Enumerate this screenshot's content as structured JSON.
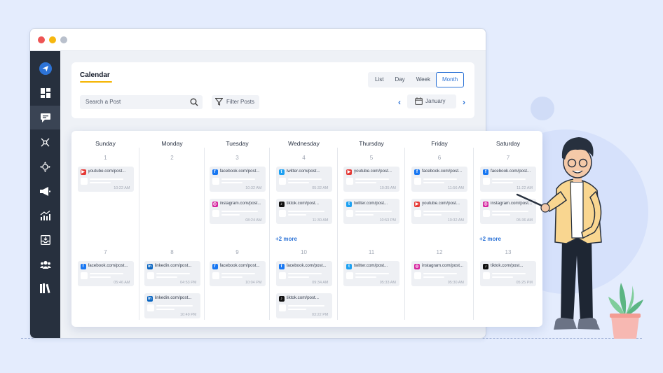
{
  "window": {
    "dots": [
      "#ee5454",
      "#f6b70f",
      "#b9c0cc"
    ]
  },
  "colors": {
    "accent": "#2d73d6",
    "sidebar": "#27303e",
    "underline": "#f5b400"
  },
  "sidebar": {
    "items": [
      {
        "icon": "send-icon",
        "active": false,
        "brand": true
      },
      {
        "icon": "dashboard-icon",
        "active": false
      },
      {
        "icon": "calendar-posts-icon",
        "active": true
      },
      {
        "icon": "network-icon",
        "active": false
      },
      {
        "icon": "move-icon",
        "active": false
      },
      {
        "icon": "megaphone-icon",
        "active": false
      },
      {
        "icon": "analytics-icon",
        "active": false
      },
      {
        "icon": "inbox-icon",
        "active": false
      },
      {
        "icon": "users-icon",
        "active": false
      },
      {
        "icon": "library-icon",
        "active": false
      }
    ]
  },
  "header": {
    "title": "Calendar",
    "views": [
      "List",
      "Day",
      "Week",
      "Month"
    ],
    "active_view": "Month",
    "search_placeholder": "Search a Post",
    "filter_label": "Filter Posts",
    "month": "January",
    "prev": "‹",
    "next": "›"
  },
  "calendar": {
    "days": [
      {
        "name": "Sunday",
        "weeks": [
          {
            "date": "1",
            "posts": [
              {
                "net": "youtube",
                "text": "youtube.com/post...",
                "time": "10:22 AM"
              }
            ],
            "more": ""
          },
          {
            "date": "7",
            "posts": [
              {
                "net": "facebook",
                "text": "facebook.com/post...",
                "time": "05:46 AM"
              }
            ],
            "more": ""
          }
        ]
      },
      {
        "name": "Monday",
        "weeks": [
          {
            "date": "2",
            "posts": [],
            "more": ""
          },
          {
            "date": "8",
            "posts": [
              {
                "net": "linkedin",
                "text": "linkedin.com/post...",
                "time": "04:53 PM"
              },
              {
                "net": "linkedin",
                "text": "linkedin.com/post...",
                "time": "10:49 PM"
              }
            ],
            "more": ""
          }
        ]
      },
      {
        "name": "Tuesday",
        "weeks": [
          {
            "date": "3",
            "posts": [
              {
                "net": "facebook",
                "text": "facebook.com/post...",
                "time": "10:32 AM"
              },
              {
                "net": "instagram",
                "text": "instagram.com/post...",
                "time": "08:24 AM"
              }
            ],
            "more": ""
          },
          {
            "date": "9",
            "posts": [
              {
                "net": "facebook",
                "text": "facebook.com/post...",
                "time": "10:04 PM"
              }
            ],
            "more": ""
          }
        ]
      },
      {
        "name": "Wednesday",
        "weeks": [
          {
            "date": "4",
            "posts": [
              {
                "net": "twitter",
                "text": "twitter.com/post...",
                "time": "05:32 AM"
              },
              {
                "net": "tiktok",
                "text": "tiktok.com/post...",
                "time": "11:30 AM"
              }
            ],
            "more": "+2 more"
          },
          {
            "date": "10",
            "posts": [
              {
                "net": "facebook",
                "text": "facebook.com/post...",
                "time": "09:34 AM"
              },
              {
                "net": "tiktok",
                "text": "tiktok.com/post...",
                "time": "03:22 PM"
              }
            ],
            "more": ""
          }
        ]
      },
      {
        "name": "Thursday",
        "weeks": [
          {
            "date": "5",
            "posts": [
              {
                "net": "youtube",
                "text": "youtube.com/post...",
                "time": "10:35 AM"
              },
              {
                "net": "twitter",
                "text": "twitter.com/post...",
                "time": "10:53 PM"
              }
            ],
            "more": ""
          },
          {
            "date": "11",
            "posts": [
              {
                "net": "twitter",
                "text": "twitter.com/post...",
                "time": "05:33 AM"
              }
            ],
            "more": ""
          }
        ]
      },
      {
        "name": "Friday",
        "weeks": [
          {
            "date": "6",
            "posts": [
              {
                "net": "facebook",
                "text": "facebook.com/post...",
                "time": "11:56 AM"
              },
              {
                "net": "youtube",
                "text": "youtube.com/post...",
                "time": "10:32 AM"
              }
            ],
            "more": ""
          },
          {
            "date": "12",
            "posts": [
              {
                "net": "instagram",
                "text": "instagram.com/post...",
                "time": "05:30 AM"
              }
            ],
            "more": ""
          }
        ]
      },
      {
        "name": "Saturday",
        "weeks": [
          {
            "date": "7",
            "posts": [
              {
                "net": "facebook",
                "text": "facebook.com/post...",
                "time": "11:22 AM"
              },
              {
                "net": "instagram",
                "text": "instagram.com/post...",
                "time": "05:36 AM"
              }
            ],
            "more": "+2 more"
          },
          {
            "date": "13",
            "posts": [
              {
                "net": "tiktok",
                "text": "tiktok.com/post...",
                "time": "05:25 PM"
              }
            ],
            "more": ""
          }
        ]
      }
    ]
  },
  "network_colors": {
    "youtube": "#e53935",
    "facebook": "#1877f2",
    "twitter": "#1da1f2",
    "instagram": "#d6249f",
    "tiktok": "#111111",
    "linkedin": "#0a66c2"
  }
}
